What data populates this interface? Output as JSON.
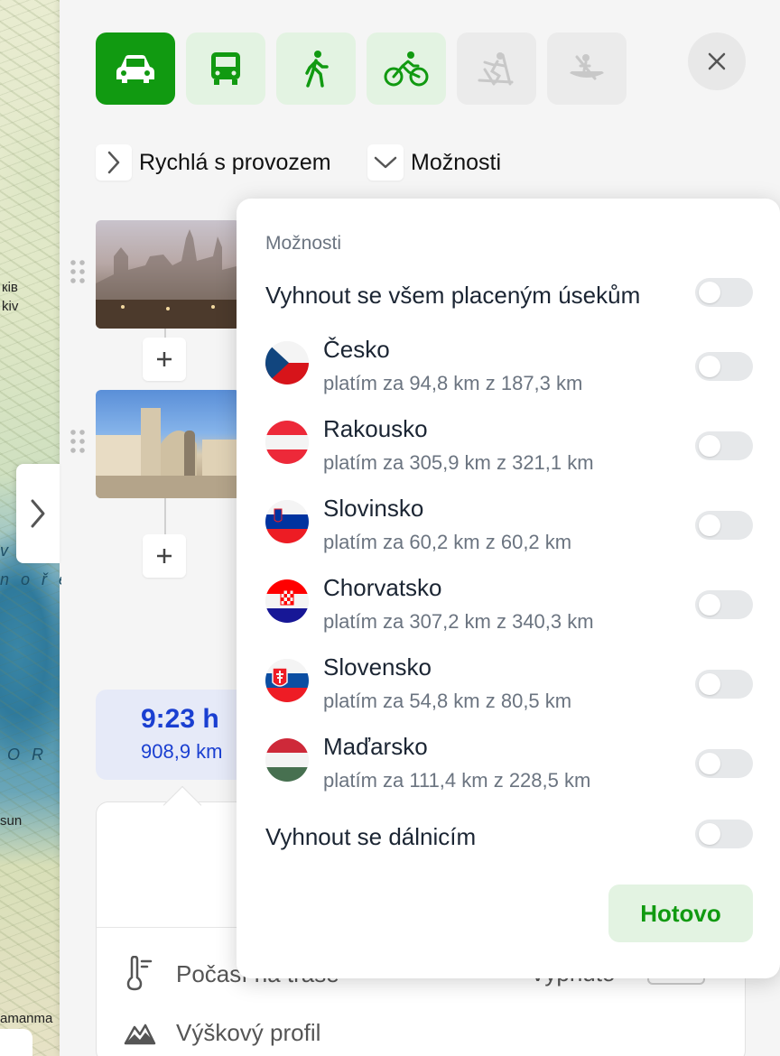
{
  "map": {
    "labels": [
      "кiв",
      "kiv",
      "sun",
      "amanma"
    ],
    "sea_letters": [
      "v s",
      "n o ř e",
      "O R"
    ]
  },
  "modes": [
    {
      "name": "car",
      "state": "active"
    },
    {
      "name": "bus",
      "state": "normal"
    },
    {
      "name": "walk",
      "state": "normal"
    },
    {
      "name": "bike",
      "state": "normal"
    },
    {
      "name": "ski",
      "state": "disabled"
    },
    {
      "name": "boat",
      "state": "disabled"
    }
  ],
  "route_type_label": "Rychlá s provozem",
  "options_label": "Možnosti",
  "summary": {
    "time": "9:23 h",
    "distance": "908,9 km"
  },
  "details": {
    "weather_label": "Počasí na trase",
    "weather_action": "Vypnuto",
    "elevation_label": "Výškový profil"
  },
  "popup": {
    "title": "Možnosti",
    "avoid_tolls_label": "Vyhnout se všem placeným úsekům",
    "avoid_tolls_on": false,
    "countries": [
      {
        "name": "Česko",
        "detail": "platím za 94,8 km z 187,3 km",
        "flag": "cz",
        "on": false
      },
      {
        "name": "Rakousko",
        "detail": "platím za 305,9 km z 321,1 km",
        "flag": "at",
        "on": false
      },
      {
        "name": "Slovinsko",
        "detail": "platím za 60,2 km z 60,2 km",
        "flag": "si",
        "on": false
      },
      {
        "name": "Chorvatsko",
        "detail": "platím za 307,2 km z 340,3 km",
        "flag": "hr",
        "on": false
      },
      {
        "name": "Slovensko",
        "detail": "platím za 54,8 km z 80,5 km",
        "flag": "sk",
        "on": false
      },
      {
        "name": "Maďarsko",
        "detail": "platím za 111,4 km z 228,5 km",
        "flag": "hu",
        "on": false
      }
    ],
    "avoid_highways_label": "Vyhnout se dálnicím",
    "avoid_highways_on": false,
    "done_label": "Hotovo"
  },
  "colors": {
    "accent_green": "#119a11",
    "light_green": "#e3f3e2",
    "summary_blue": "#1a3fd1"
  }
}
